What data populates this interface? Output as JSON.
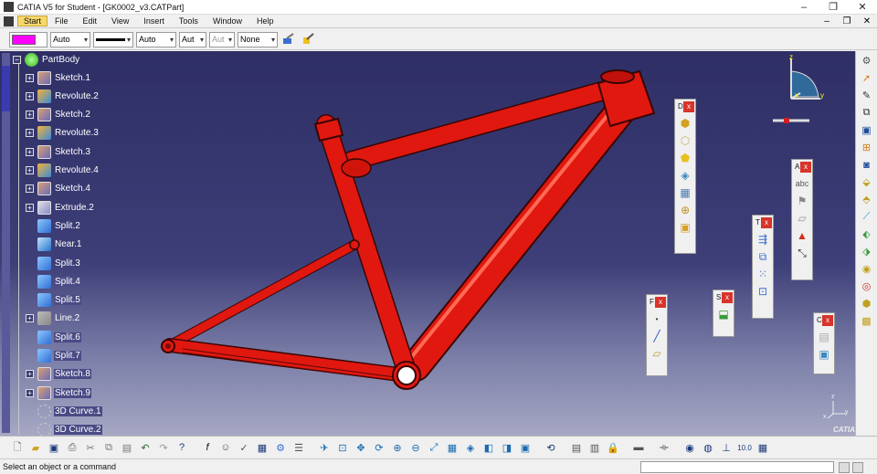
{
  "window": {
    "title": "CATIA V5 for Student - [GK0002_v3.CATPart]",
    "minimize": "–",
    "maximize": "❐",
    "close": "✕"
  },
  "menu": {
    "items": [
      "Start",
      "File",
      "Edit",
      "View",
      "Insert",
      "Tools",
      "Window",
      "Help"
    ]
  },
  "properties": {
    "fill_color": "#ff00ff",
    "transparency": "Auto",
    "line_thickness": "Auto",
    "line_type": "Aut",
    "point_type": "Aut",
    "layer": "None"
  },
  "tree": {
    "root": "PartBody",
    "items": [
      {
        "label": "Sketch.1",
        "icon": "sketch-icon",
        "expand": true,
        "hl": false
      },
      {
        "label": "Revolute.2",
        "icon": "revolute-icon",
        "expand": true,
        "hl": false
      },
      {
        "label": "Sketch.2",
        "icon": "sketch-icon",
        "expand": true,
        "hl": false
      },
      {
        "label": "Revolute.3",
        "icon": "revolute-icon",
        "expand": true,
        "hl": false
      },
      {
        "label": "Sketch.3",
        "icon": "sketch-icon",
        "expand": true,
        "hl": false
      },
      {
        "label": "Revolute.4",
        "icon": "revolute-icon",
        "expand": true,
        "hl": false
      },
      {
        "label": "Sketch.4",
        "icon": "sketch-icon",
        "expand": true,
        "hl": false
      },
      {
        "label": "Extrude.2",
        "icon": "extrude-icon",
        "expand": true,
        "hl": false
      },
      {
        "label": "Split.2",
        "icon": "split-icon",
        "expand": false,
        "hl": false
      },
      {
        "label": "Near.1",
        "icon": "near-icon",
        "expand": false,
        "hl": false
      },
      {
        "label": "Split.3",
        "icon": "split-icon",
        "expand": false,
        "hl": false
      },
      {
        "label": "Split.4",
        "icon": "split-icon",
        "expand": false,
        "hl": true
      },
      {
        "label": "Split.5",
        "icon": "split-icon",
        "expand": false,
        "hl": true
      },
      {
        "label": "Line.2",
        "icon": "line-icon",
        "expand": true,
        "hl": false
      },
      {
        "label": "Split.6",
        "icon": "split-icon",
        "expand": false,
        "hl": true
      },
      {
        "label": "Split.7",
        "icon": "split-icon",
        "expand": false,
        "hl": true
      },
      {
        "label": "Sketch.8",
        "icon": "sketch-icon",
        "expand": true,
        "hl": true
      },
      {
        "label": "Sketch.9",
        "icon": "sketch-icon",
        "expand": true,
        "hl": true
      },
      {
        "label": "3D Curve.1",
        "icon": "curve-icon",
        "expand": false,
        "hl": true
      },
      {
        "label": "3D Curve.2",
        "icon": "curve-icon",
        "expand": false,
        "hl": true
      }
    ]
  },
  "floating_toolbars": {
    "d": "D",
    "a": "A",
    "t": "T",
    "f": "F",
    "s": "S",
    "c": "C",
    "close": "x"
  },
  "compass": {
    "z": "z",
    "y": "y",
    "x": "x"
  },
  "axis": {
    "z": "z",
    "y": "y",
    "x": "x"
  },
  "brand": "CATIA",
  "status": {
    "message": "Select an object or a command",
    "command_input": ""
  },
  "colors": {
    "part": "#e0160e",
    "background_top": "#2f2f66",
    "background_bottom": "#a6a8c4",
    "highlight": "#ff00ff"
  }
}
